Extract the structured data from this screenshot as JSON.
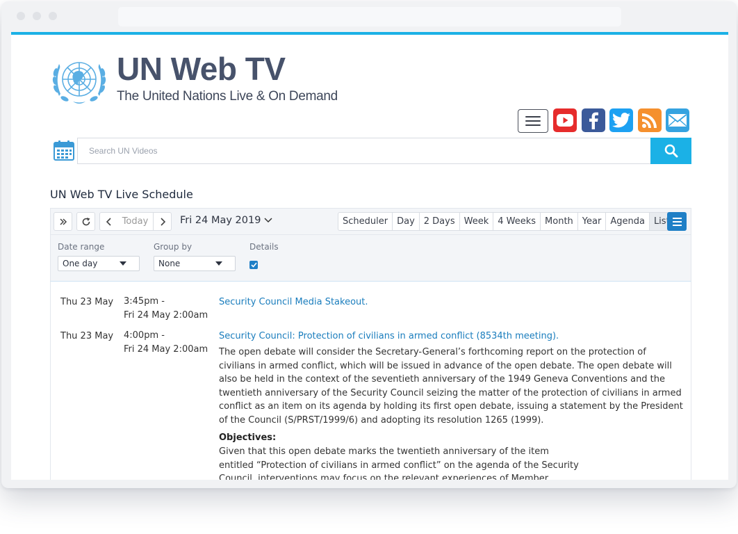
{
  "site": {
    "title": "UN Web TV",
    "subtitle": "The United Nations Live & On Demand"
  },
  "search": {
    "placeholder": "Search UN Videos"
  },
  "colors": {
    "accent": "#1bb1e6",
    "title": "#47526b",
    "link": "#1a7dbd",
    "youtube": "#e62c2c",
    "facebook": "#3b5a9a",
    "twitter": "#1da1f2",
    "rss": "#f5902e",
    "email": "#35a3e0"
  },
  "social": [
    {
      "name": "youtube-icon"
    },
    {
      "name": "facebook-icon"
    },
    {
      "name": "twitter-icon"
    },
    {
      "name": "rss-icon"
    },
    {
      "name": "email-icon"
    }
  ],
  "schedule": {
    "title": "UN Web TV Live Schedule",
    "today_label": "Today",
    "current_date": "Fri 24 May 2019",
    "views": [
      "Scheduler",
      "Day",
      "2 Days",
      "Week",
      "4 Weeks",
      "Month",
      "Year",
      "Agenda",
      "List"
    ],
    "active_view": "List",
    "filters": {
      "date_range_label": "Date range",
      "date_range_value": "One day",
      "group_by_label": "Group by",
      "group_by_value": "None",
      "details_label": "Details",
      "details_checked": true
    },
    "events": [
      {
        "date": "Thu 23 May",
        "time_start": "3:45pm -",
        "time_end": "Fri 24 May 2:00am",
        "title": "Security Council Media Stakeout."
      },
      {
        "date": "Thu 23 May",
        "time_start": "4:00pm -",
        "time_end": "Fri 24 May 2:00am",
        "title": "Security Council: Protection of civilians in armed conflict (8534th meeting).",
        "description": "The open debate will consider the Secretary-General’s forthcoming report on the protection of civilians in armed conflict, which will be issued in advance of the open debate. The open debate will also be held in the context of the seventieth anniversary of the 1949 Geneva Conventions and the twentieth anniversary of the Security Council seizing the matter of the protection of civilians in armed conflict as an item on its agenda by holding its first open debate, issuing a statement by the President of the Council (S/PRST/1999/6) and adopting its resolution 1265 (1999).",
        "objectives_heading": "Objectives:",
        "objectives_text": "Given that this open debate marks the twentieth anniversary of the item entitled “Protection of civilians in armed conflict” on the agenda of the Security Council, interventions may focus on the relevant experiences of Member States, including:"
      }
    ]
  }
}
